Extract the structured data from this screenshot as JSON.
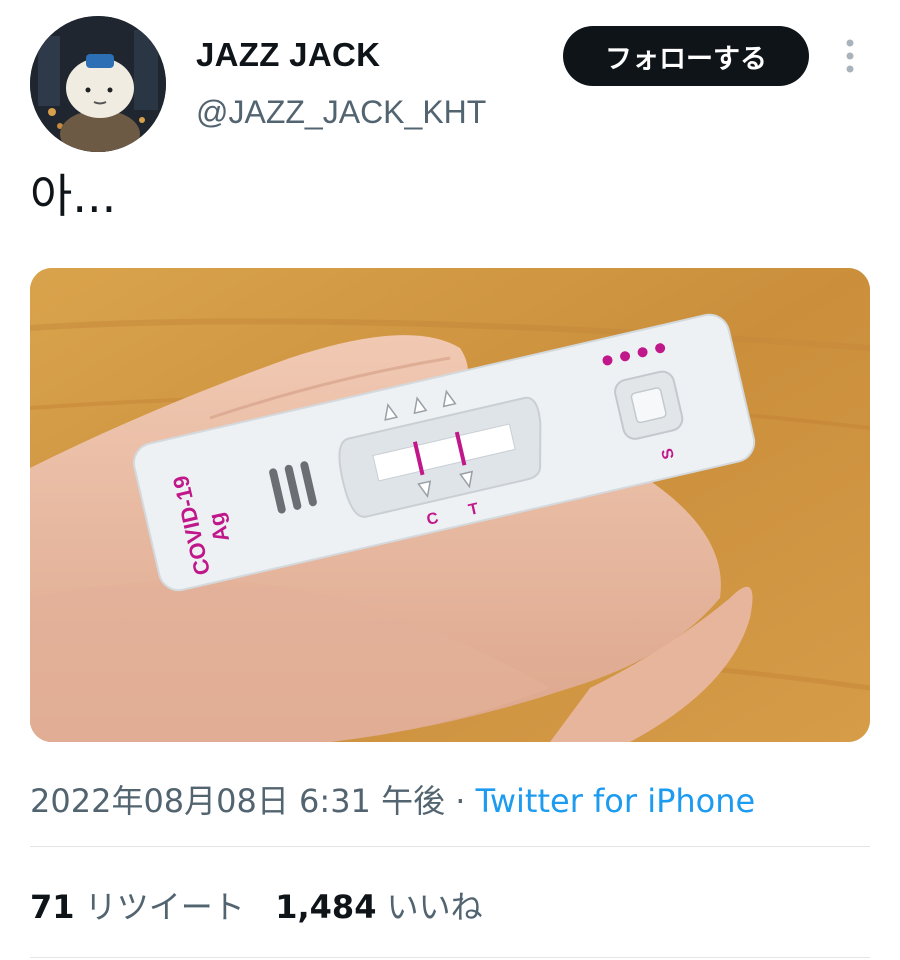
{
  "user": {
    "display_name": "JAZZ JACK",
    "handle": "@JAZZ_JACK_KHT",
    "avatar_icon": "cartoon-character-avatar"
  },
  "follow_button": {
    "label": "フォローする"
  },
  "more_icon": "more-vertical-icon",
  "tweet": {
    "text": "아..."
  },
  "media": {
    "description_icon": "covid-test-photo",
    "test_label_line1": "COVID-19",
    "test_label_line2": "Ag",
    "control_label": "C",
    "test_label": "T",
    "sample_label": "S"
  },
  "meta": {
    "timestamp": "2022年08月08日 6:31 午後",
    "separator": " · ",
    "source": "Twitter for iPhone"
  },
  "stats": {
    "retweets_count": "71",
    "retweets_label": "リツイート",
    "likes_count": "1,484",
    "likes_label": "いいね"
  },
  "colors": {
    "accent": "#1d9bf0",
    "button_bg": "#0f1419",
    "secondary_text": "#536471",
    "test_magenta": "#c0188a"
  }
}
